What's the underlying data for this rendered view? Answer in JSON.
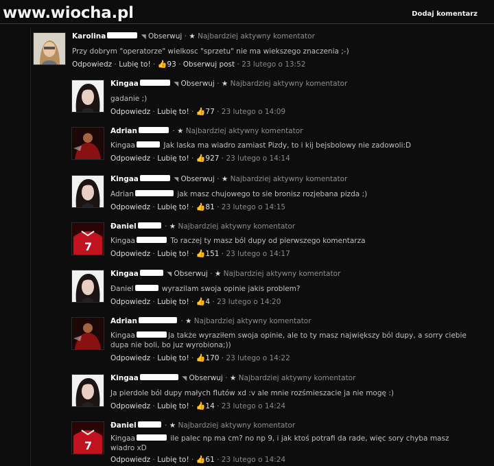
{
  "site": {
    "watermark": "www.wiocha.pl",
    "add_comment": "Dodaj komentarz"
  },
  "labels": {
    "follow": "Obserwuj",
    "badge": "Najbardziej aktywny komentator",
    "reply": "Odpowiedz",
    "like": "Lubię to!",
    "follow_post": "Obserwuj post"
  },
  "comments": [
    {
      "name": "Karolina",
      "text": "Przy dobrym \"operatorze\" wielkosc \"sprzetu\" nie ma wiekszego znaczenia ;-)",
      "likes": "93",
      "time": "23 lutego o 13:52"
    },
    {
      "name": "Kingaa",
      "text": "gadanie ;)",
      "likes": "77",
      "time": "23 lutego o 14:09"
    },
    {
      "name": "Adrian",
      "mention": "Kingaa",
      "text": "Jak laska ma wiadro zamiast Pizdy, to i kij bejsbolowy nie zadowoli:D",
      "likes": "927",
      "time": "23 lutego o 14:14"
    },
    {
      "name": "Kingaa",
      "mention": "Adrian",
      "text": "jak masz chujowego to sie bronisz rozjebana pizda ;)",
      "likes": "81",
      "time": "23 lutego o 14:15"
    },
    {
      "name": "Đaniel",
      "mention": "Kingaa",
      "text": "To raczej ty masz ból dupy od pierwszego komentarza",
      "likes": "151",
      "time": "23 lutego o 14:17"
    },
    {
      "name": "Kingaa",
      "mention": "Đaniel",
      "text": "wyrazilam swoja opinie jakis problem?",
      "likes": "4",
      "time": "23 lutego o 14:20"
    },
    {
      "name": "Adrian",
      "mention": "Kingaa",
      "text": "ja także wyraziłem swoja opinie, ale to ty masz największy ból dupy, a sorry ciebie",
      "text2": "dupa nie boli, bo juz wyrobiona;))",
      "likes": "170",
      "time": "23 lutego o 14:22"
    },
    {
      "name": "Kingaa",
      "text": "Ja pierdole ból dupy małych flutów xd :v ale mnie rozśmieszacie ja nie mogę :)",
      "likes": "14",
      "time": "23 lutego o 14:24"
    },
    {
      "name": "Đaniel",
      "mention": "Kingaa",
      "text": "ile palec np ma cm? no np 9, i jak ktoś potrafi da rade, więc sory chyba masz",
      "text2": "wiadro xD",
      "likes": "61",
      "time": "23 lutego o 14:24"
    }
  ],
  "colors": {
    "background": "#0d0d0d",
    "name": "#ffffff",
    "text": "#bfbfbf",
    "meta": "#8a8a8a"
  }
}
